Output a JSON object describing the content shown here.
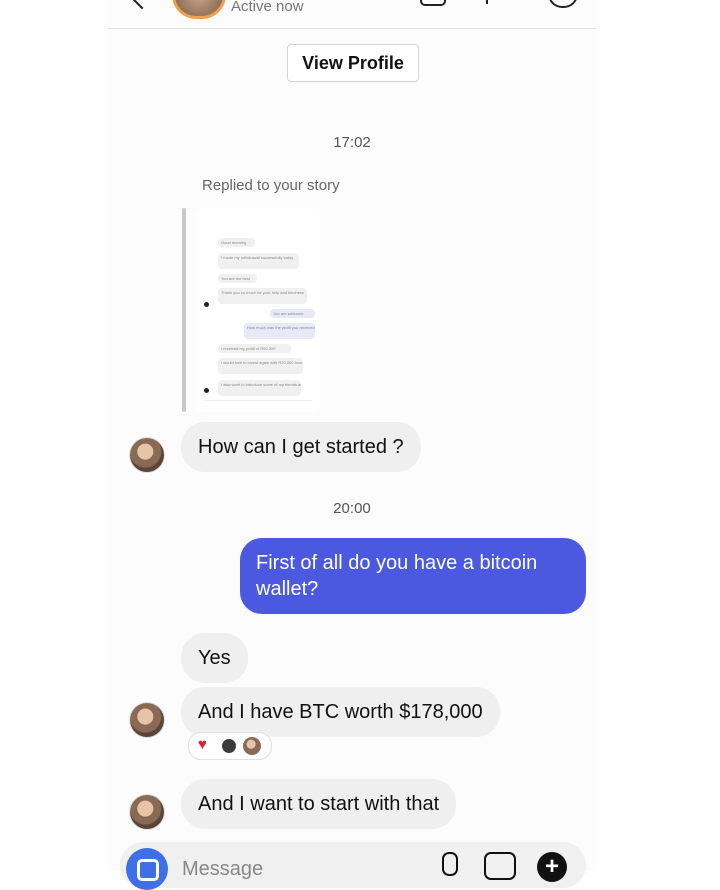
{
  "header": {
    "status": "Active now"
  },
  "view_profile_label": "View Profile",
  "thread": {
    "timestamp_1": "17:02",
    "story_reply_label": "Replied to your story",
    "story_preview_lines": [
      "Good morning",
      "I made my withdrawal successfully today",
      "You are the best",
      "Thank you so much for your help and kindness",
      "You are welcome",
      "How much was the profit you received?",
      "I received my profit of R60,000",
      "I would love to invest again with R20,000 how much will be my profit?",
      "I also want to introduce some of my friends and family to your platform"
    ],
    "message_1": "How can I get started ?",
    "timestamp_2": "20:00",
    "message_2": "First of all do you have a bitcoin wallet?",
    "message_3": "Yes",
    "message_4": "And I have BTC worth $178,000",
    "message_4_reactions": [
      "heart",
      "person-reaction",
      "avatar-reaction"
    ],
    "message_5": "And I want to start with that"
  },
  "composer": {
    "placeholder": "Message"
  },
  "colors": {
    "outgoing_bubble": "#4a59e0",
    "incoming_bubble": "#efefef",
    "camera_button": "#3f6fe6",
    "heart": "#e0202d"
  }
}
